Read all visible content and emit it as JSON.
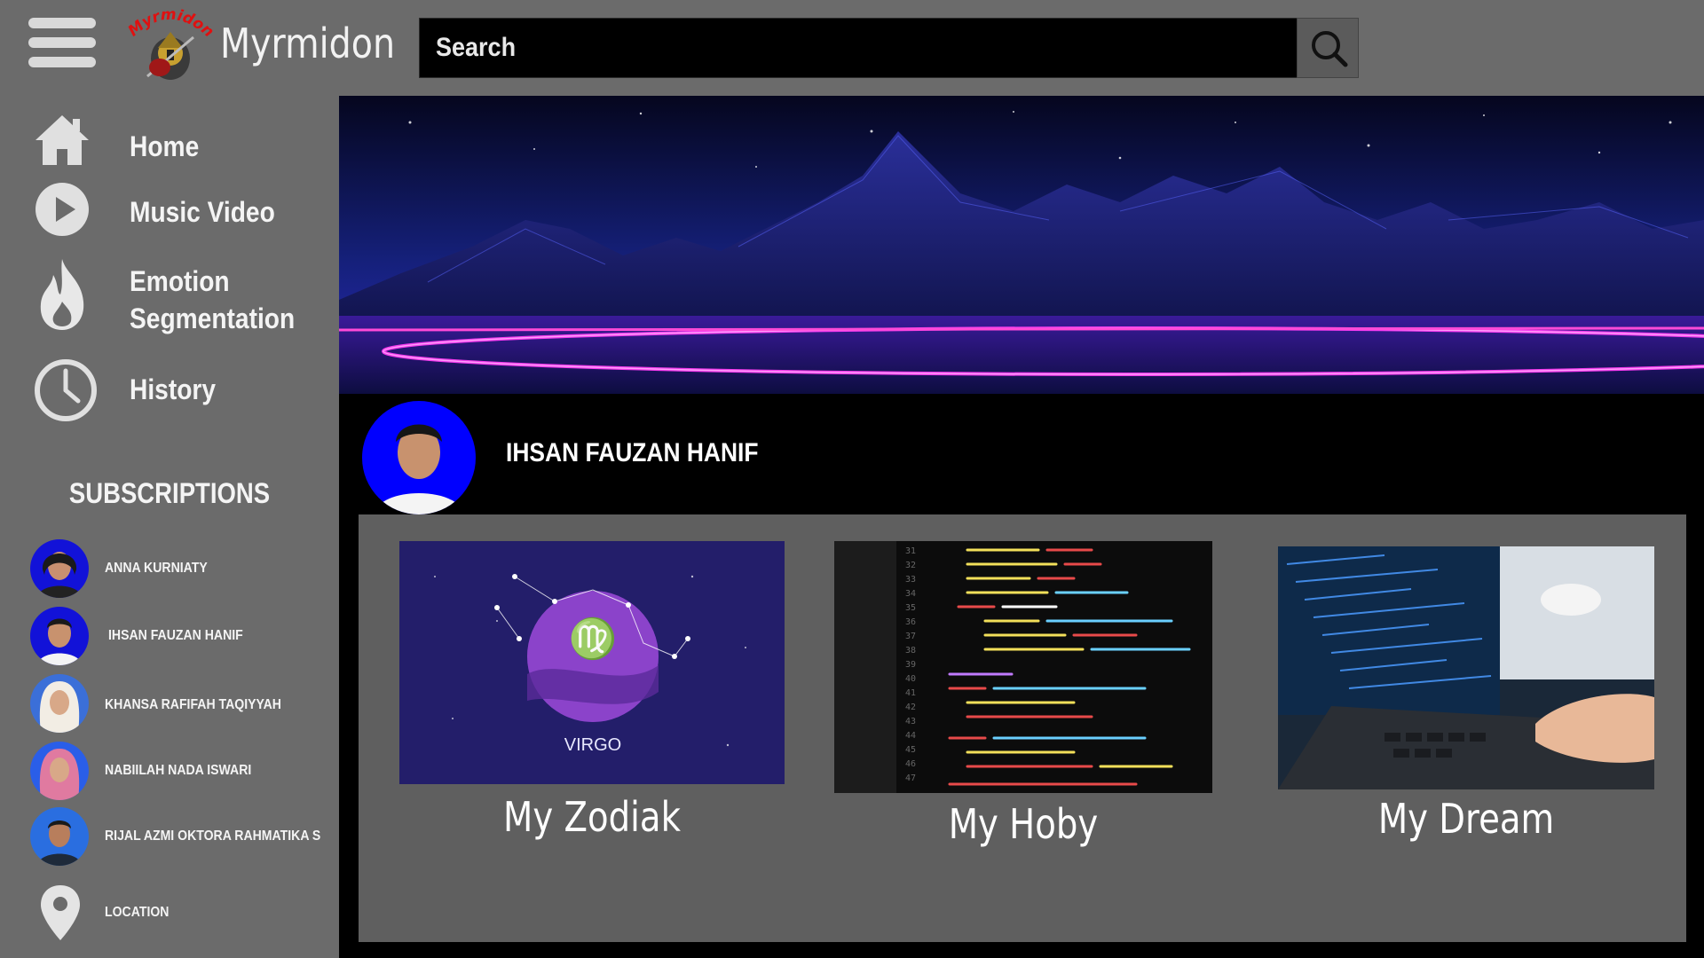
{
  "app": {
    "brand": "Myrmidon",
    "logo_text": "Myrmidon"
  },
  "search": {
    "placeholder": "Search",
    "icon": "search-icon"
  },
  "sidebar": {
    "nav": [
      {
        "label": "Home",
        "icon": "home-icon"
      },
      {
        "label": "Music Video",
        "icon": "play-icon"
      },
      {
        "label": "Emotion\nSegmentation",
        "line1": "Emotion",
        "line2": "Segmentation",
        "icon": "flame-icon"
      },
      {
        "label": "History",
        "icon": "clock-icon"
      }
    ],
    "subscriptions_heading": "SUBSCRIPTIONS",
    "subscriptions": [
      {
        "name": "ANNA KURNIATY"
      },
      {
        "name": "IHSAN FAUZAN HANIF"
      },
      {
        "name": "KHANSA RAFIFAH TAQIYYAH"
      },
      {
        "name": "NABIILAH NADA ISWARI"
      },
      {
        "name": "RIJAL AZMI OKTORA RAHMATIKA S"
      }
    ],
    "location_label": "LOCATION"
  },
  "profile": {
    "name": "IHSAN FAUZAN HANIF"
  },
  "cards": [
    {
      "title": "My Zodiak",
      "thumb_text": "VIRGO"
    },
    {
      "title": "My Hoby"
    },
    {
      "title": "My Dream"
    }
  ],
  "colors": {
    "sidebar_bg": "#6b6b6b",
    "avatar_bg": "#1212d8",
    "neon_pink": "#ff3df5",
    "neon_blue": "#3b5bff"
  }
}
